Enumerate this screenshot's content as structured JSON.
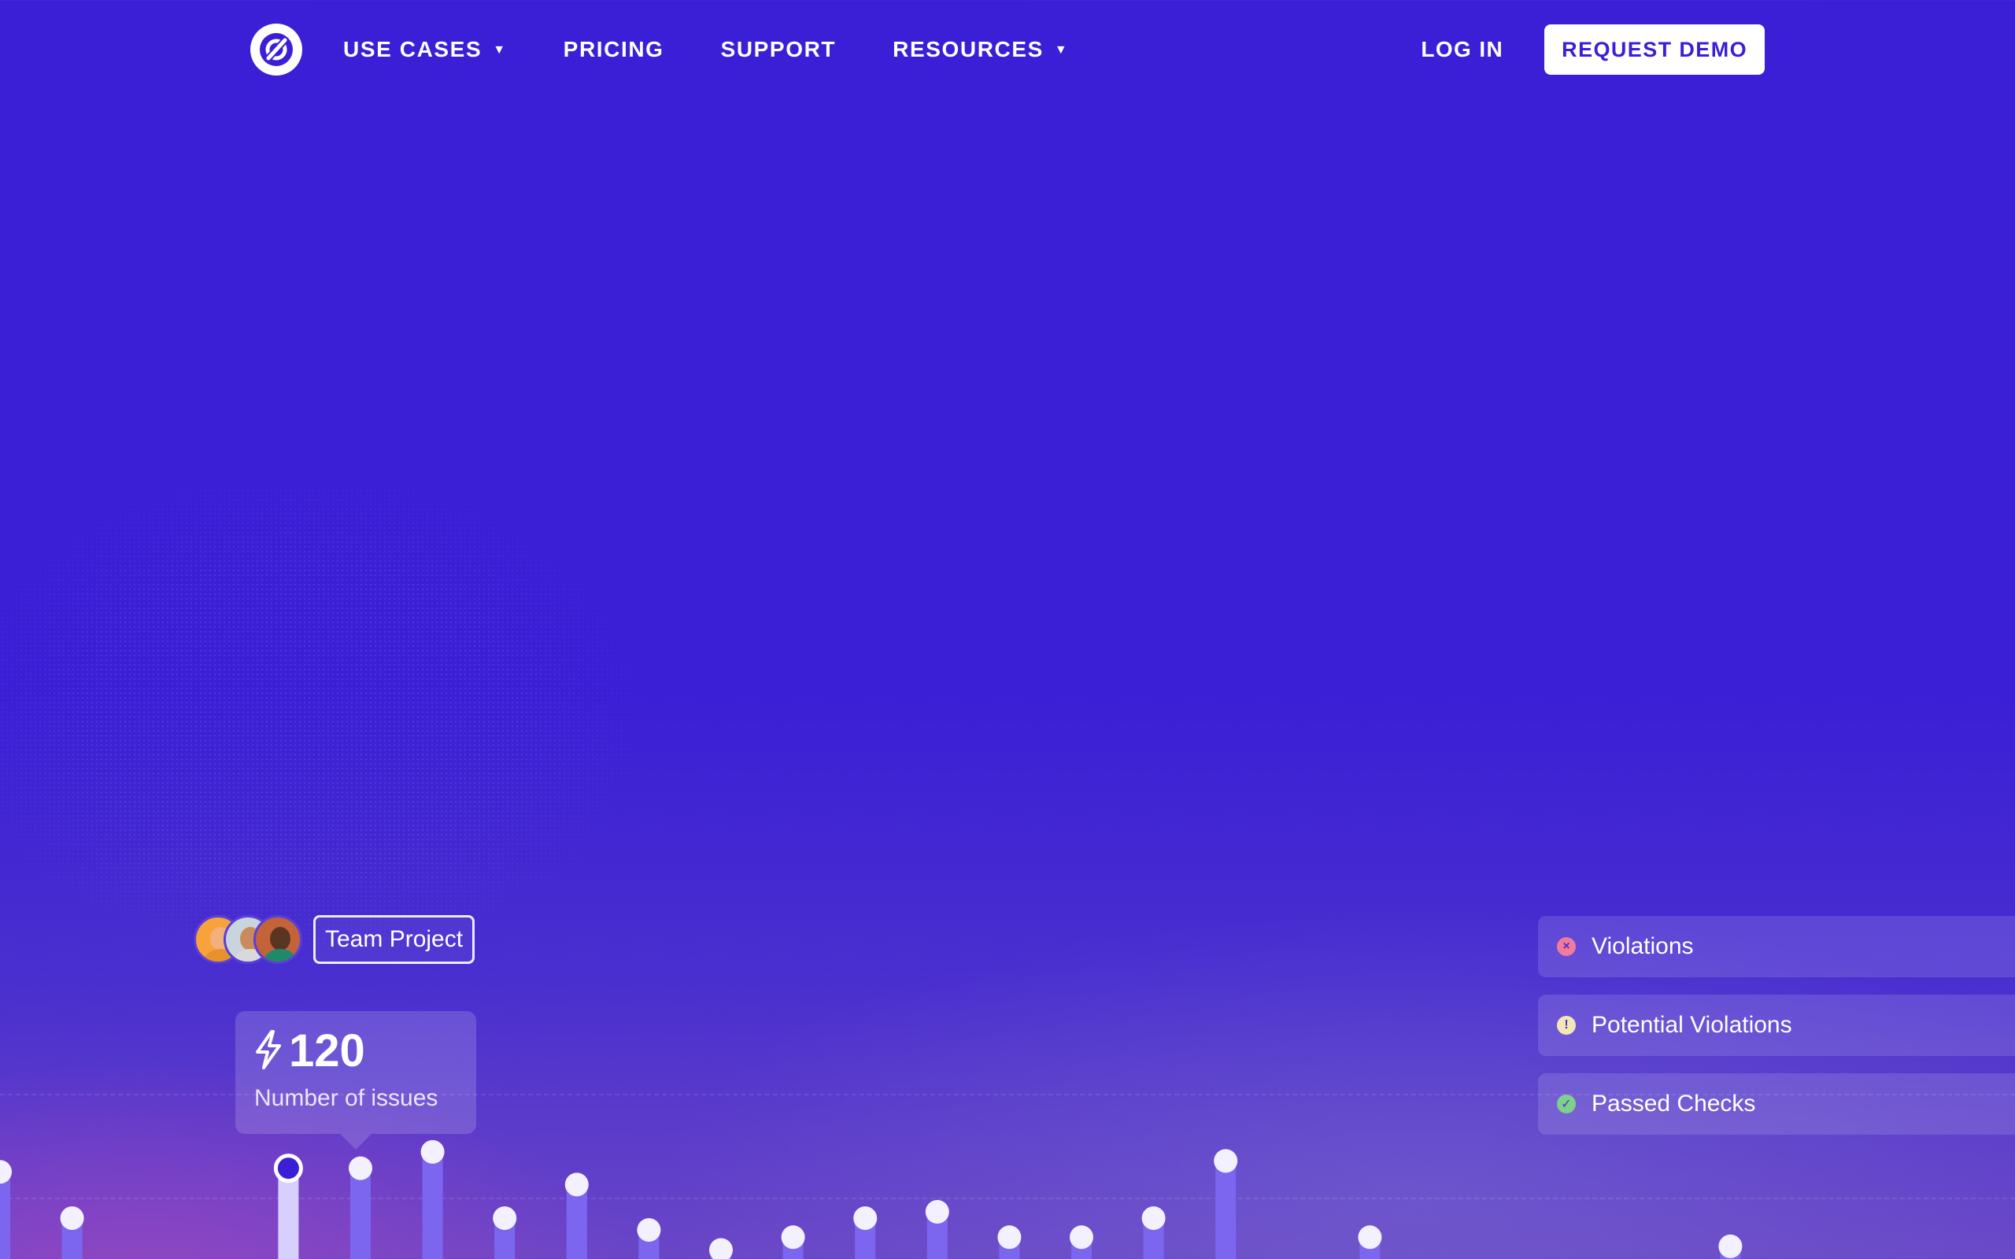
{
  "nav": {
    "items": [
      {
        "label": "USE CASES",
        "dropdown": true
      },
      {
        "label": "PRICING",
        "dropdown": false
      },
      {
        "label": "SUPPORT",
        "dropdown": false
      },
      {
        "label": "RESOURCES",
        "dropdown": true
      }
    ],
    "login": "LOG IN",
    "cta": "REQUEST DEMO",
    "caret": "▼"
  },
  "team": {
    "label": "Team Project",
    "avatars": [
      {
        "skin": "#f2b07a",
        "shirt": "#e8922c",
        "bg": "#f7a23b"
      },
      {
        "skin": "#c98b5c",
        "shirt": "#d9d9d9",
        "bg": "#c9d4dc"
      },
      {
        "skin": "#5a3522",
        "shirt": "#1e8a6a",
        "bg": "#c2633a"
      }
    ]
  },
  "tooltip": {
    "value": "120",
    "label": "Number of issues",
    "icon": "bolt-icon"
  },
  "checks": [
    {
      "label": "Violations",
      "icon": "x-circle-icon",
      "color": "#f07b9a",
      "glyph": "×"
    },
    {
      "label": "Potential Violations",
      "icon": "alert-circle-icon",
      "color": "#f3e7b8",
      "glyph": "!"
    },
    {
      "label": "Passed Checks",
      "icon": "check-circle-icon",
      "color": "#7ed08a",
      "glyph": "✓"
    }
  ],
  "colors": {
    "background": "#3a1fd6",
    "bar": "#7c66f0",
    "bar_selected": "#d7d0ff",
    "dot": "#f3f1ff"
  },
  "chart_data": {
    "type": "bar",
    "selected_index": 4,
    "values": [
      96,
      45,
      null,
      null,
      100,
      100,
      118,
      45,
      82,
      32,
      10,
      24,
      45,
      52,
      24,
      24,
      45,
      108,
      null,
      24,
      null,
      null,
      null,
      null,
      14
    ]
  }
}
